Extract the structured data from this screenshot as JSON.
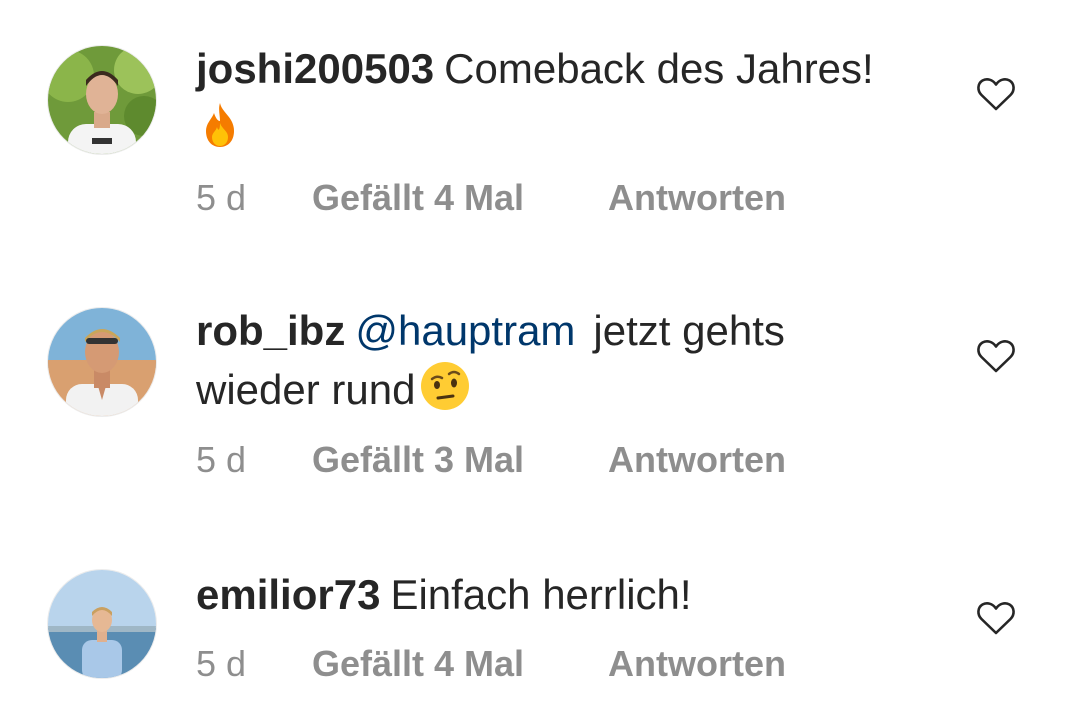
{
  "comments": [
    {
      "username": "joshi200503",
      "mention": "",
      "text": "Comeback des Jahres!",
      "emoji": "fire-emoji",
      "time": "5 d",
      "likes": "Gefällt 4 Mal",
      "reply": "Antworten",
      "avatar_icon": "avatar-joshi200503"
    },
    {
      "username": "rob_ibz",
      "mention": "@hauptram",
      "text": "jetzt gehts wieder rund",
      "emoji": "raised-eyebrow-emoji",
      "time": "5 d",
      "likes": "Gefällt 3 Mal",
      "reply": "Antworten",
      "avatar_icon": "avatar-rob_ibz"
    },
    {
      "username": "emilior73",
      "mention": "",
      "text": "Einfach herrlich!",
      "emoji": "",
      "time": "5 d",
      "likes": "Gefällt 4 Mal",
      "reply": "Antworten",
      "avatar_icon": "avatar-emilior73"
    }
  ],
  "colors": {
    "text": "#262626",
    "meta": "#8e8e8e",
    "mention": "#00376b"
  },
  "icons": {
    "like": "heart-outline-icon"
  }
}
